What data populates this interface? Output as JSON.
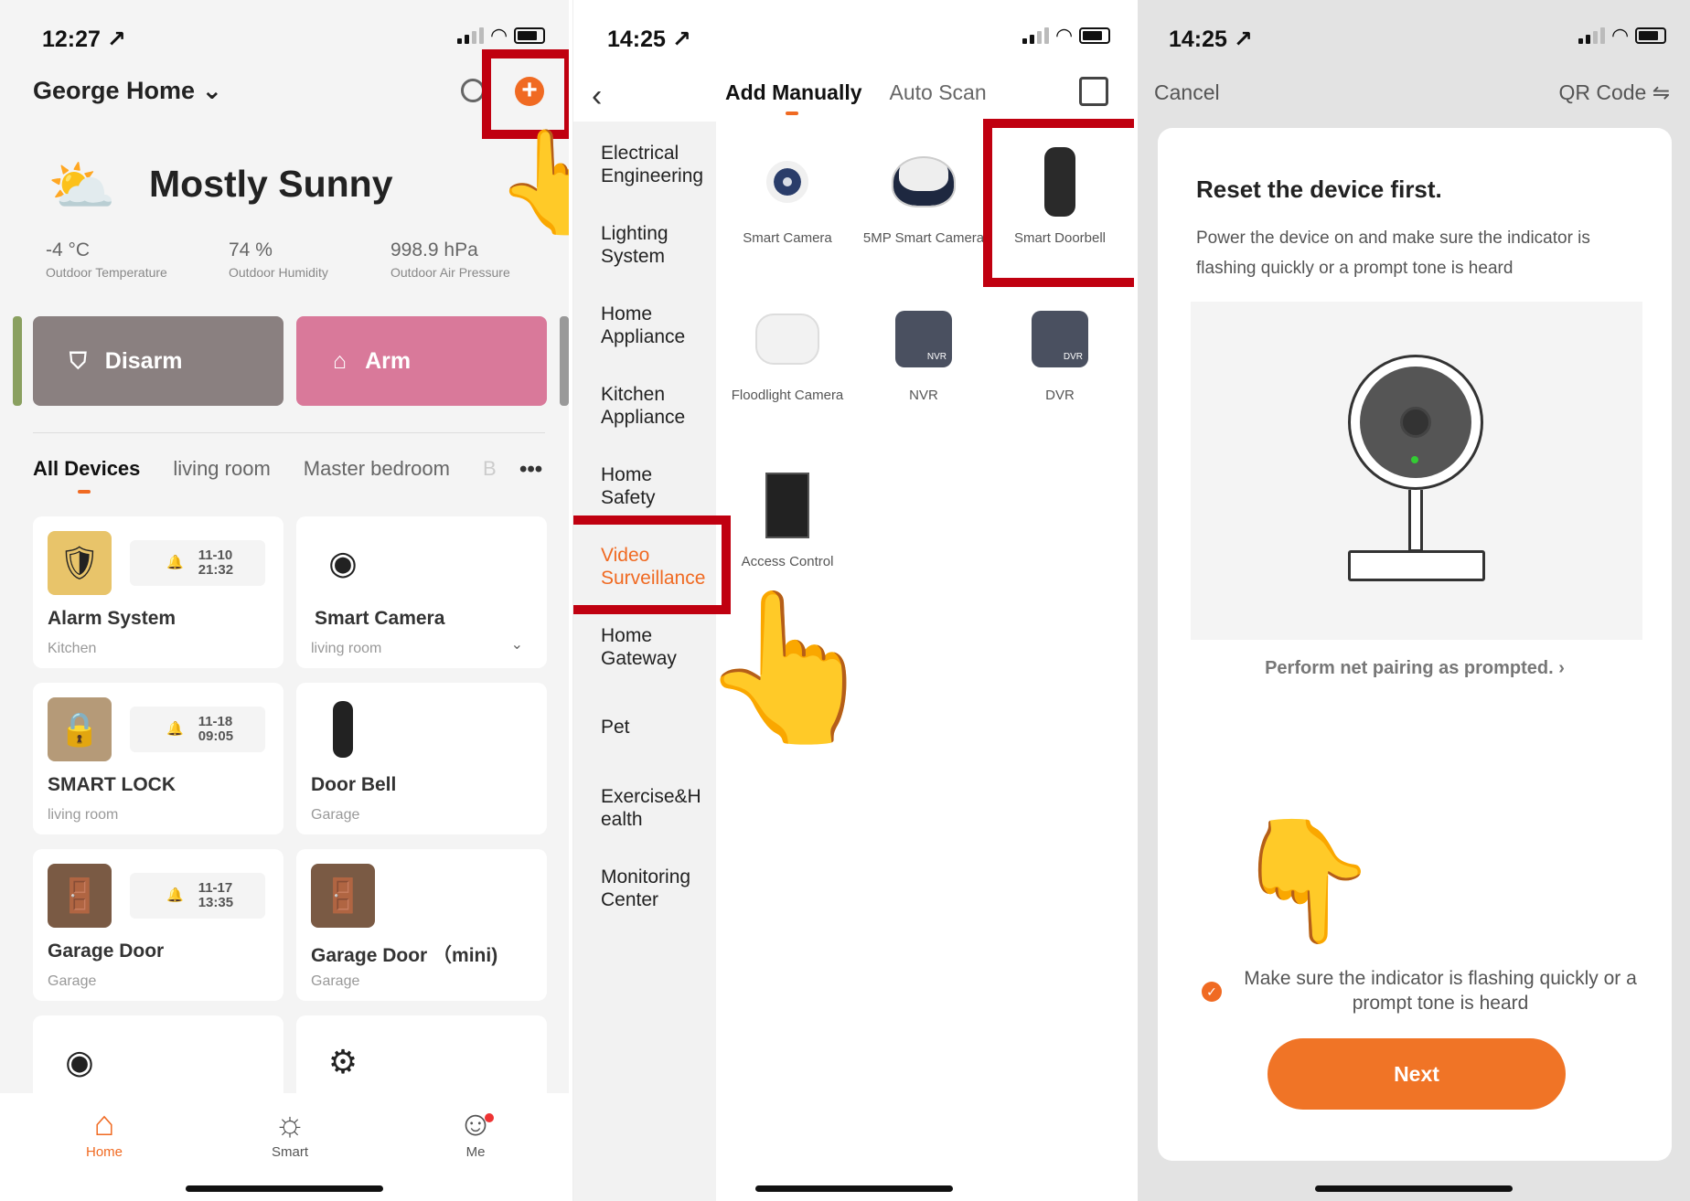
{
  "panel1": {
    "time": "12:27 ↗",
    "home_title": "George Home ⌄",
    "weather": {
      "title": "Mostly Sunny",
      "stats": [
        {
          "value": "-4 °C",
          "label": "Outdoor Temperature"
        },
        {
          "value": "74 %",
          "label": "Outdoor Humidity"
        },
        {
          "value": "998.9 hPa",
          "label": "Outdoor Air Pressure"
        }
      ]
    },
    "disarm_label": "Disarm",
    "arm_label": "Arm",
    "room_tabs": [
      "All Devices",
      "living room",
      "Master bedroom",
      "B"
    ],
    "more": "•••",
    "devices": [
      {
        "name": "Alarm System",
        "room": "Kitchen",
        "notif_date": "11-10",
        "notif_time": "21:32"
      },
      {
        "name": "Smart Camera",
        "room": "living room"
      },
      {
        "name": "SMART LOCK",
        "room": "living room",
        "notif_date": "11-18",
        "notif_time": "09:05"
      },
      {
        "name": "Door Bell",
        "room": "Garage"
      },
      {
        "name": "Garage Door",
        "room": "Garage",
        "notif_date": "11-17",
        "notif_time": "13:35"
      },
      {
        "name": "Garage Door （mini)",
        "room": "Garage"
      }
    ],
    "nav": [
      "Home",
      "Smart",
      "Me"
    ],
    "plus": "+"
  },
  "panel2": {
    "time": "14:25 ↗",
    "tabs": [
      "Add Manually",
      "Auto Scan"
    ],
    "categories": [
      "Electrical Engineering",
      "Lighting System",
      "Home Appliance",
      "Kitchen Appliance",
      "Home Safety",
      "Video Surveillance",
      "Home Gateway",
      "Pet",
      "Exercise&H ealth",
      "Monitoring Center"
    ],
    "devices": [
      "Smart Camera",
      "5MP Smart Camera",
      "Smart Doorbell",
      "Floodlight Camera",
      "NVR",
      "DVR",
      "Access Control"
    ],
    "nvr_badge": "NVR",
    "dvr_badge": "DVR"
  },
  "panel3": {
    "time": "14:25 ↗",
    "cancel": "Cancel",
    "qr": "QR Code ⇋",
    "title": "Reset the device first.",
    "description": "Power the device on and make sure the indicator is flashing quickly or a prompt tone is heard",
    "pairing_link": "Perform net pairing as prompted. ›",
    "confirm": "Make sure the indicator is flashing quickly or a prompt tone is heard",
    "next": "Next"
  },
  "colors": {
    "accent": "#f06a22",
    "highlight": "#c00010"
  }
}
